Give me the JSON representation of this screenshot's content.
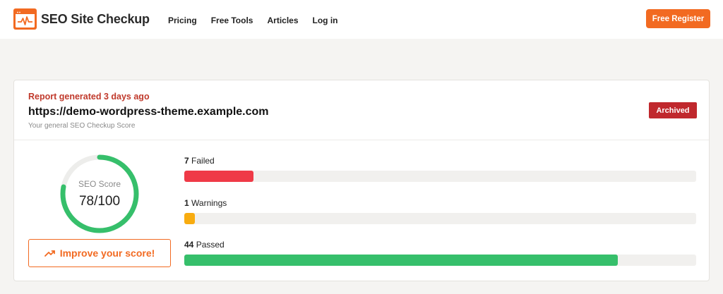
{
  "header": {
    "brand": "SEO Site Checkup",
    "nav": [
      "Pricing",
      "Free Tools",
      "Articles",
      "Log in"
    ],
    "register_label": "Free Register",
    "logo_icon": "pulse-chart-icon",
    "accent_color": "#f26a21"
  },
  "report": {
    "generated": "Report generated 3 days ago",
    "url": "https://demo-wordpress-theme.example.com",
    "subtitle": "Your general SEO Checkup Score",
    "status_badge": "Archived"
  },
  "score": {
    "label": "SEO Score",
    "value_text": "78/100",
    "value": 78,
    "max": 100,
    "color": "#36bf6b",
    "improve_label": "Improve your score!",
    "improve_icon": "trending-up-icon"
  },
  "metrics": [
    {
      "count": "7",
      "label": "Failed",
      "fraction": 0.135,
      "color": "#ef3a47"
    },
    {
      "count": "1",
      "label": "Warnings",
      "fraction": 0.02,
      "color": "#f8ac10"
    },
    {
      "count": "44",
      "label": "Passed",
      "fraction": 0.847,
      "color": "#36bf6b"
    }
  ]
}
